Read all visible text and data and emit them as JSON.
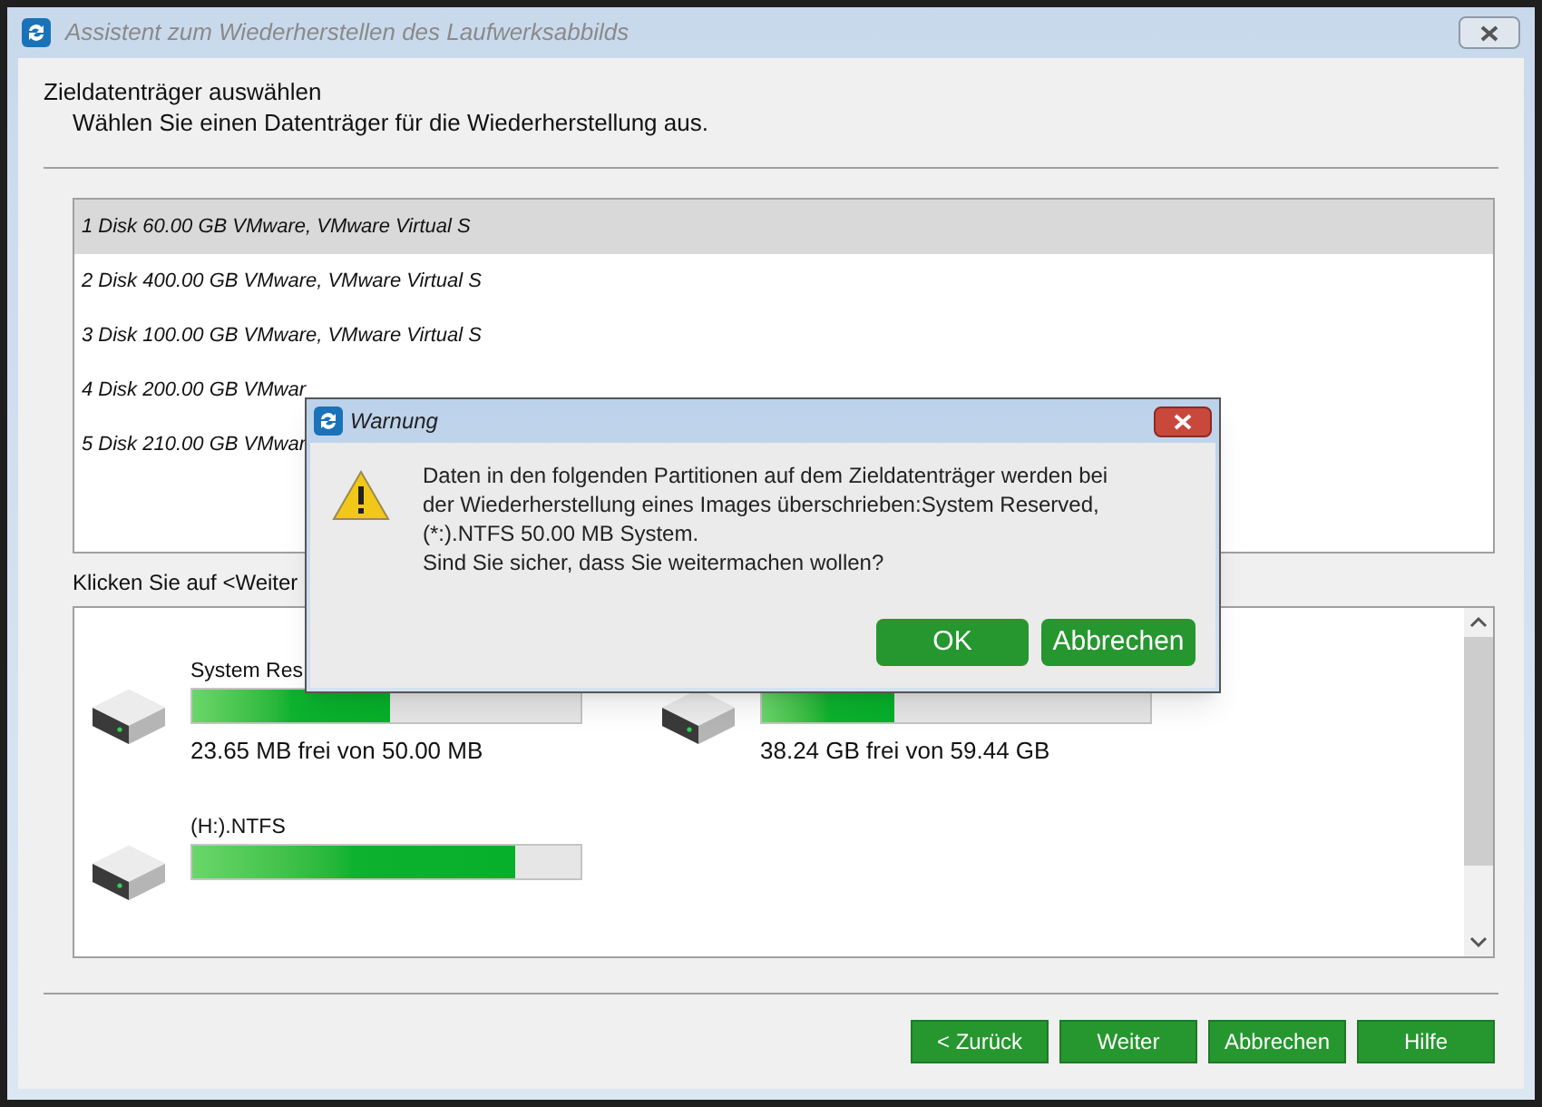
{
  "window": {
    "title": "Assistent zum Wiederherstellen des Laufwerksabbilds"
  },
  "heading": "Zieldatenträger auswählen",
  "subheading": "Wählen Sie einen Datenträger für die Wiederherstellung aus.",
  "disks": [
    {
      "label": "1 Disk 60.00 GB VMware,  VMware Virtual S",
      "selected": true
    },
    {
      "label": "2 Disk 400.00 GB VMware,  VMware Virtual S",
      "selected": false
    },
    {
      "label": "3 Disk 100.00 GB VMware,  VMware Virtual S",
      "selected": false
    },
    {
      "label": "4 Disk 200.00 GB VMwar",
      "selected": false
    },
    {
      "label": "5 Disk 210.00 GB VMwar",
      "selected": false
    }
  ],
  "hint": "Klicken Sie auf <Weiter",
  "partitions": [
    {
      "name": "System Res",
      "level": 0.51,
      "free": "23.65 MB frei von 50.00 MB"
    },
    {
      "level": 0.34,
      "free": "38.24 GB frei von 59.44 GB"
    },
    {
      "name": "(H:).NTFS",
      "level": 0.83
    }
  ],
  "buttons": [
    "< Zurück",
    "Weiter",
    "Abbrechen",
    "Hilfe"
  ],
  "dialog": {
    "title": "Warnung",
    "message": [
      "Daten in den folgenden Partitionen auf dem Zieldatenträger werden bei",
      "der Wiederherstellung eines Images überschrieben:System Reserved,",
      "(*:).NTFS 50.00 MB System.",
      "Sind Sie sicher, dass Sie weitermachen wollen?"
    ],
    "buttons": [
      "OK",
      "Abbrechen"
    ]
  }
}
